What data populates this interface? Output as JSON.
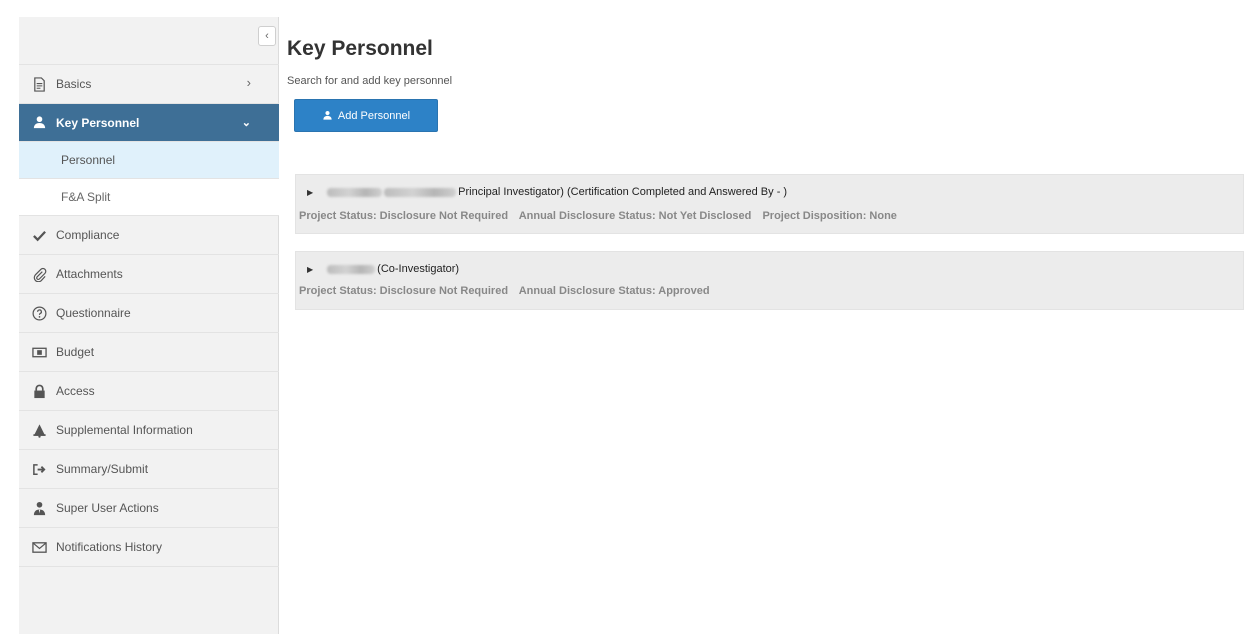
{
  "sidebar": {
    "collapse_glyph": "‹",
    "items": [
      {
        "label": "Basics",
        "icon": "document-icon",
        "chevron": "›"
      },
      {
        "label": "Key Personnel",
        "icon": "user-icon",
        "chevron": "⌄",
        "active": true,
        "children": [
          {
            "label": "Personnel",
            "selected": true
          },
          {
            "label": "F&A Split"
          }
        ]
      },
      {
        "label": "Compliance",
        "icon": "check-icon"
      },
      {
        "label": "Attachments",
        "icon": "paperclip-icon"
      },
      {
        "label": "Questionnaire",
        "icon": "question-circle-icon"
      },
      {
        "label": "Budget",
        "icon": "money-icon"
      },
      {
        "label": "Access",
        "icon": "lock-icon"
      },
      {
        "label": "Supplemental Information",
        "icon": "bell-icon"
      },
      {
        "label": "Summary/Submit",
        "icon": "sign-out-icon"
      },
      {
        "label": "Super User Actions",
        "icon": "user-tie-icon"
      },
      {
        "label": "Notifications History",
        "icon": "envelope-icon"
      }
    ]
  },
  "main": {
    "title": "Key Personnel",
    "subtitle": "Search for and add key personnel",
    "add_button_label": "Add Personnel",
    "personnel": [
      {
        "role_text": "Principal Investigator) (Certification Completed and Answered By - )",
        "statuses": [
          "Project Status: Disclosure Not Required",
          "Annual Disclosure Status: Not Yet Disclosed",
          "Project Disposition: None"
        ]
      },
      {
        "role_text": "(Co-Investigator)",
        "statuses": [
          "Project Status: Disclosure Not Required",
          "Annual Disclosure Status: Approved"
        ]
      }
    ]
  },
  "colors": {
    "active_nav": "#3e6f96",
    "selected_subitem": "#e0f1fb",
    "primary_button": "#2d82c7",
    "card_bg": "#ececec",
    "sidebar_bg": "#f2f2f2"
  }
}
